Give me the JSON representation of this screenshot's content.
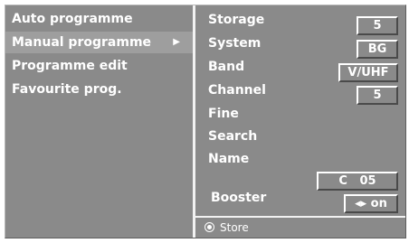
{
  "menu": {
    "items": [
      {
        "label": "Auto programme"
      },
      {
        "label": "Manual programme",
        "arrow": "▶"
      },
      {
        "label": "Programme edit"
      },
      {
        "label": "Favourite prog."
      }
    ]
  },
  "settings": {
    "storage": {
      "label": "Storage",
      "value": "5"
    },
    "system": {
      "label": "System",
      "value": "BG"
    },
    "band": {
      "label": "Band",
      "value": "V/UHF"
    },
    "channel": {
      "label": "Channel",
      "value": "5"
    },
    "fine": {
      "label": "Fine"
    },
    "search": {
      "label": "Search"
    },
    "name": {
      "label": "Name",
      "value": "C   05"
    },
    "booster": {
      "label": "Booster",
      "value": "◂▸ on"
    }
  },
  "footer": {
    "store_label": "Store"
  },
  "colors": {
    "panel": "#8a8a8a",
    "highlight": "#9e9e9e",
    "text": "#ffffff"
  }
}
